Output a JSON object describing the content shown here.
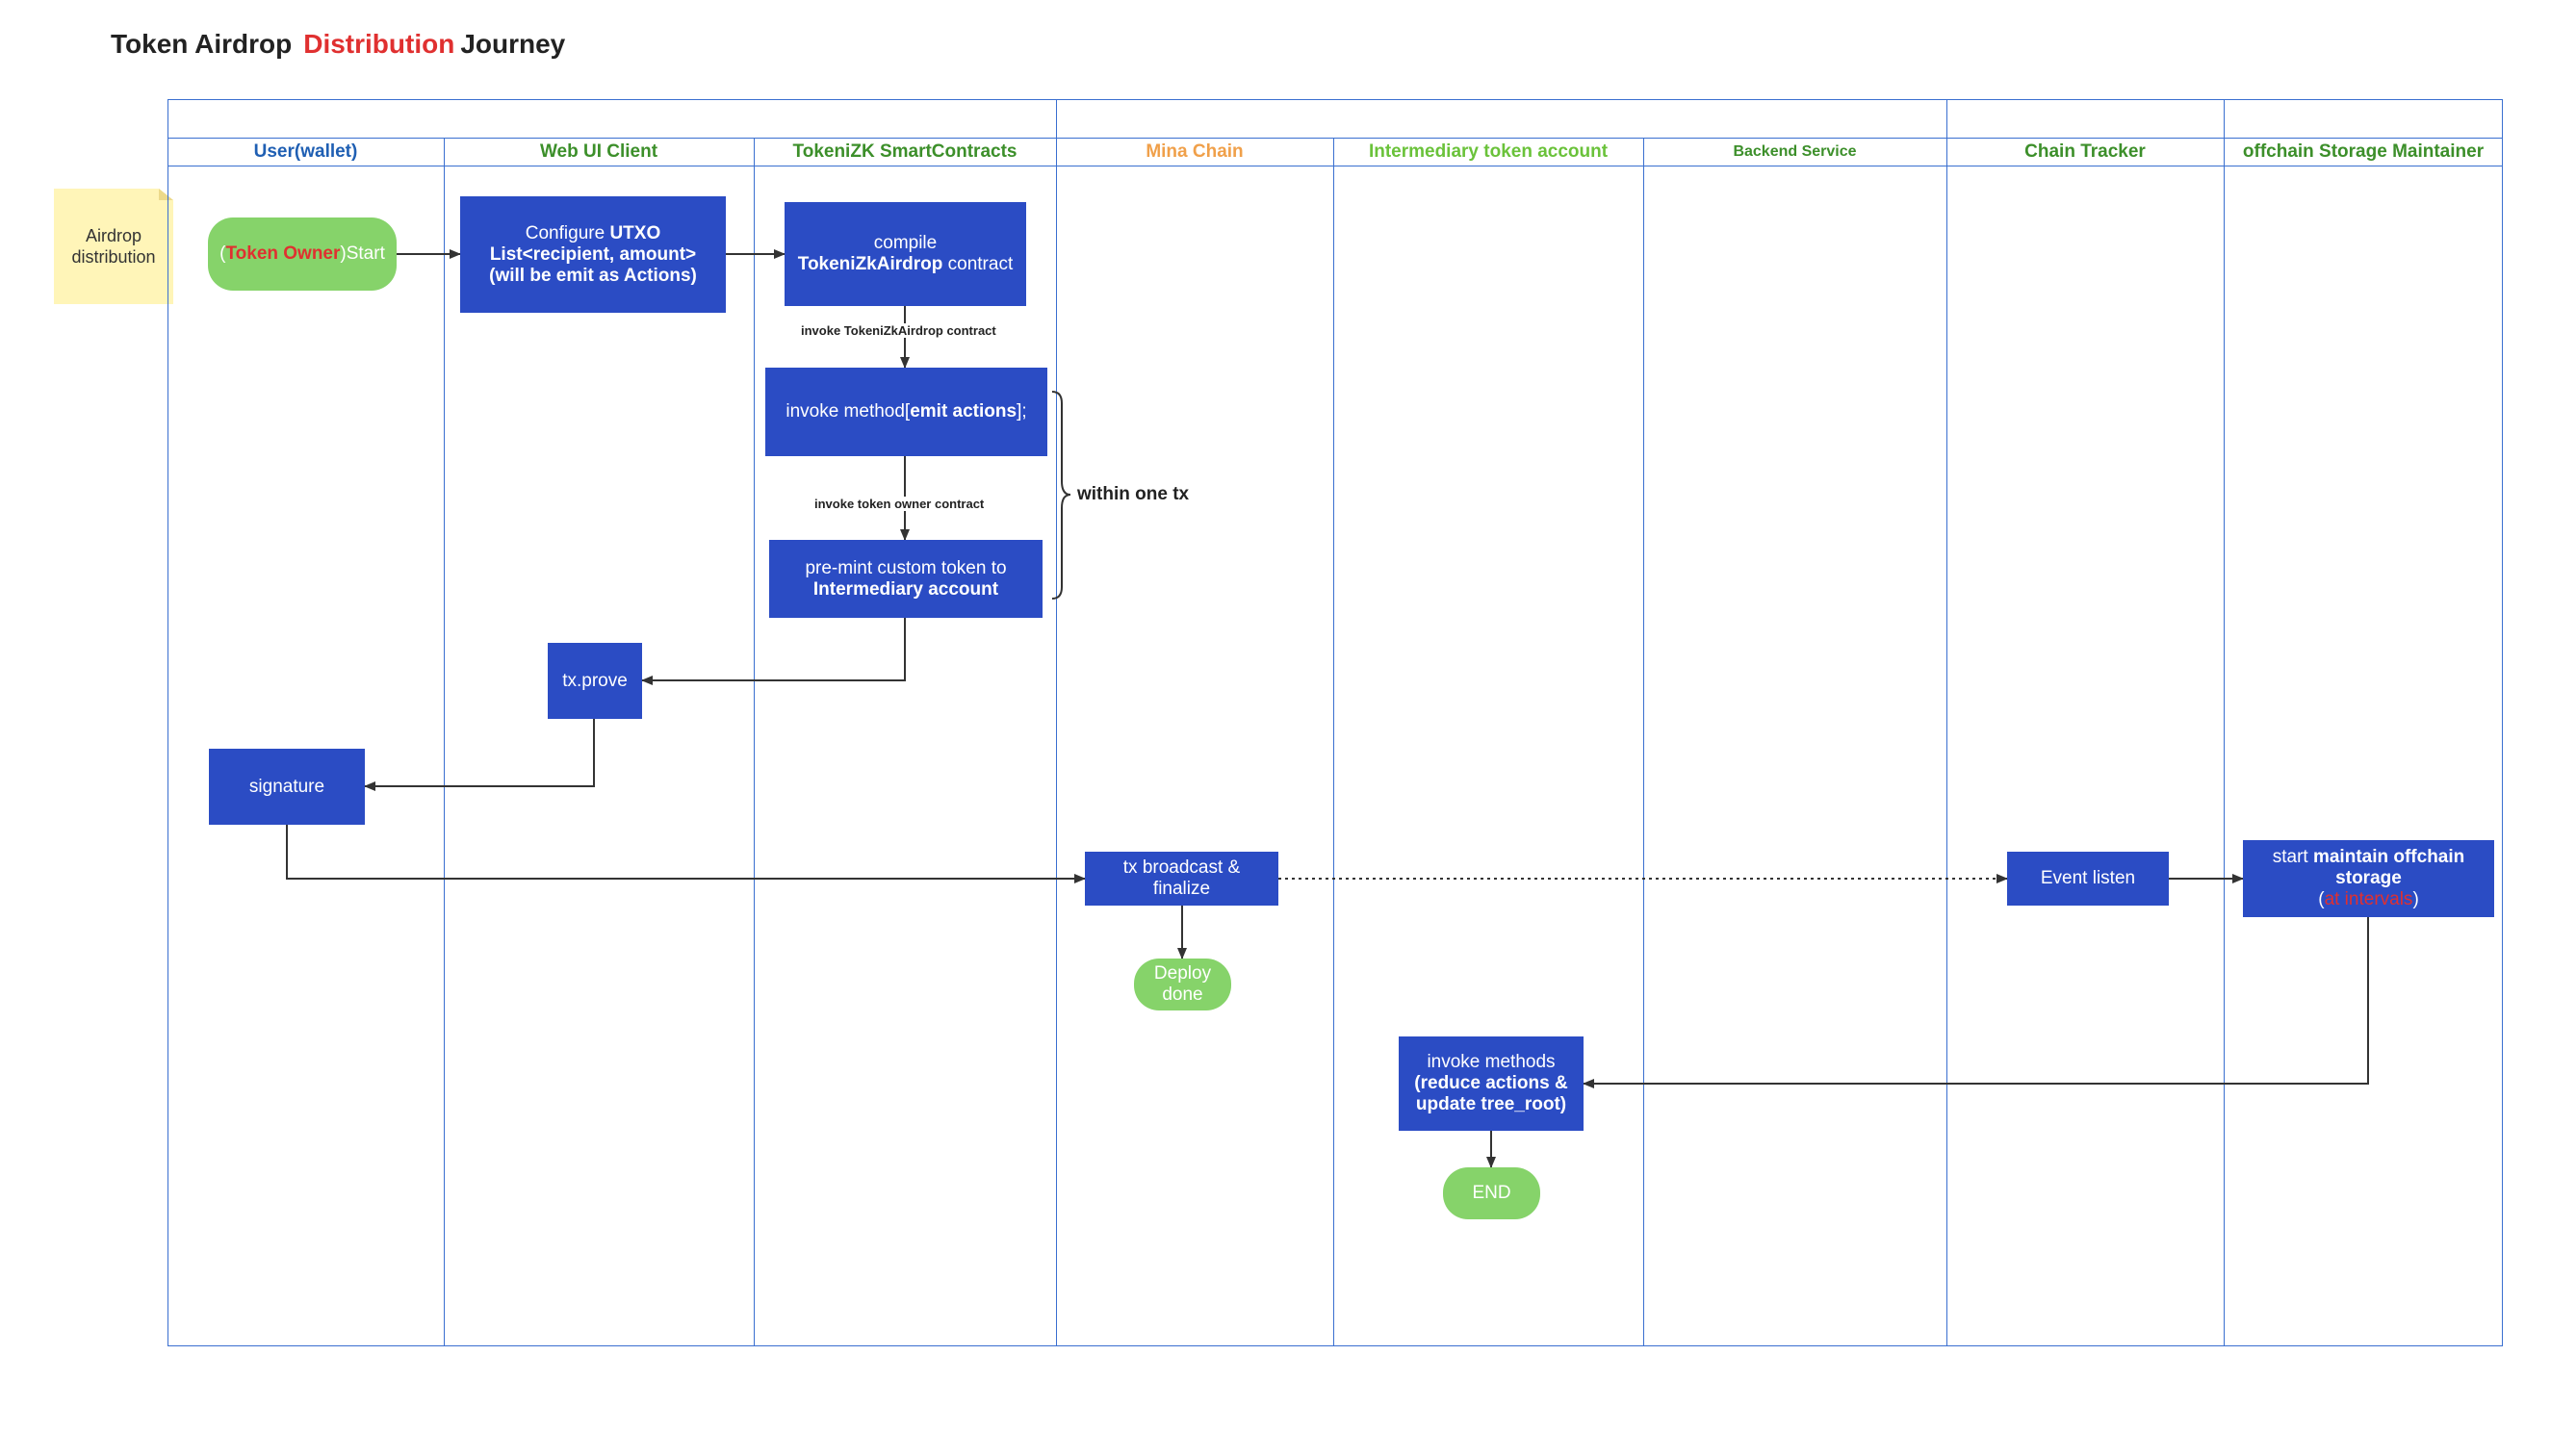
{
  "title": {
    "part1": "Token Airdrop",
    "part2": "Distribution",
    "part3": "Journey"
  },
  "colors": {
    "lane_blue": "#1f5fb3",
    "lane_green": "#3c8f2a",
    "lane_orange": "#f0a04a",
    "lane_lightgreen": "#6ac23a",
    "accent_red": "#e03030",
    "box_blue": "#2b4cc4",
    "pill_green": "#86d36a"
  },
  "note": {
    "line1": "Airdrop",
    "line2": "distribution"
  },
  "lanes": [
    {
      "label": "User(wallet)"
    },
    {
      "label": "Web UI Client"
    },
    {
      "label": "TokeniZK SmartContracts"
    },
    {
      "label": "Mina Chain"
    },
    {
      "label": "Intermediary token account"
    },
    {
      "label": "Backend Service"
    },
    {
      "label": "Chain Tracker"
    },
    {
      "label": "offchain Storage Maintainer"
    }
  ],
  "nodes": {
    "start": {
      "open": "(",
      "owner": "Token Owner",
      "close": ")",
      "label": "Start"
    },
    "configure": {
      "l1a": "Configure ",
      "l1b": "UTXO",
      "l2": "List<recipient, amount>",
      "l3": "(will be emit as Actions)"
    },
    "compile": {
      "l1": "compile",
      "l2a": "TokeniZkAirdrop",
      "l2b": " contract"
    },
    "emit": {
      "a": "invoke method[",
      "b": "emit actions",
      "c": "];"
    },
    "premint": {
      "l1": "pre-mint custom token to",
      "l2": "Intermediary account"
    },
    "prove": {
      "label": "tx.prove"
    },
    "signature": {
      "label": "signature"
    },
    "broadcast": {
      "l1": "tx broadcast &",
      "l2": "finalize"
    },
    "deploy": {
      "l1": "Deploy",
      "l2": "done"
    },
    "event": {
      "label": "Event listen"
    },
    "maintain": {
      "l1a": "start ",
      "l1b": "maintain offchain",
      "l2": "storage",
      "l3a": "(",
      "l3b": "at intervals",
      "l3c": ")"
    },
    "reduce": {
      "l1": "invoke methods",
      "l2": "(reduce actions &",
      "l3": "update tree_root)"
    },
    "end": {
      "label": "END"
    }
  },
  "edge_labels": {
    "invoke_airdrop": "invoke TokeniZkAirdrop contract",
    "invoke_owner": "invoke token owner contract",
    "within_tx": "within one tx"
  }
}
